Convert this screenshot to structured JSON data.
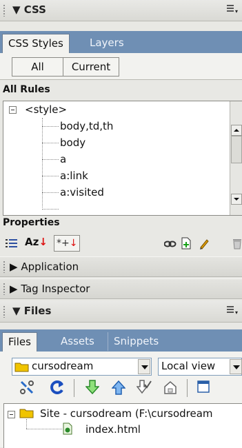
{
  "css_panel": {
    "title": "CSS",
    "tabs": [
      "CSS Styles",
      "Layers"
    ],
    "mode_buttons": [
      "All",
      "Current"
    ],
    "all_rules_label": "All Rules",
    "rules": [
      "<style>",
      "body,td,th",
      "body",
      "a",
      "a:link",
      "a:visited"
    ],
    "properties_label": "Properties",
    "toolbar_text": {
      "az": "Az",
      "star": "*+"
    }
  },
  "collapsed_panels": [
    "Application",
    "Tag Inspector"
  ],
  "files_panel": {
    "title": "Files",
    "tabs": [
      "Files",
      "Assets",
      "Snippets"
    ],
    "site_select": "cursodream",
    "view_select": "Local view",
    "tree": [
      "Site - cursodream (F:\\cursodream",
      "index.html"
    ]
  },
  "colors": {
    "tab_bar": "#6f8fb4",
    "panel_bg": "#e8e8e4"
  },
  "icons": {
    "menu": "options-menu-icon",
    "refresh": "refresh-icon",
    "connect": "connect-icon",
    "get": "get-arrow-icon",
    "put": "put-arrow-icon",
    "checkout": "check-out-icon",
    "checkin": "check-in-icon",
    "expand": "expand-icon"
  }
}
